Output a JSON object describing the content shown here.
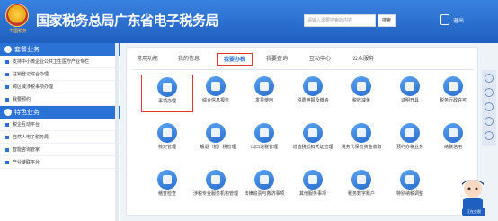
{
  "header": {
    "title": "国家税务总局广东省电子税务局",
    "emblem_text": "中国税务",
    "search_placeholder": "请输入需要搜索的内容",
    "search_button": "搜索",
    "logout": "退出"
  },
  "sidebar": {
    "section1": "套餐业务",
    "section1_items": [
      "支持中小微企业公共卫生医疗产业专栏",
      "注销登记综合办理",
      "跨区域涉税事项办理",
      "我要预约"
    ],
    "section2": "特色业务",
    "section2_items": [
      "税企互动平台",
      "自然人电子税务局",
      "智能咨询管家",
      "产业链联平台"
    ]
  },
  "tabs": [
    "常用功能",
    "我的信息",
    "我要办税",
    "我要查询",
    "互动中心",
    "公众服务"
  ],
  "active_tab": "我要办税",
  "tiles": [
    [
      "事项办理",
      "综合信息报告",
      "发票使用",
      "税费申报及缴纳",
      "税收减免",
      "证明开具",
      "税务行政许可"
    ],
    [
      "核定管理",
      "一般退（抵）税管理",
      "出口退税管理",
      "增值税抵扣凭证管理",
      "税务代保管资金收取",
      "预约办税业务",
      "纳税信用"
    ],
    [
      "稽查检查",
      "涉税专业服务机构管理",
      "法律追责与救济事项",
      "其他服务事项",
      "税务数字账户",
      "特别纳税调整",
      ""
    ]
  ],
  "mascot_label": "正在交税"
}
